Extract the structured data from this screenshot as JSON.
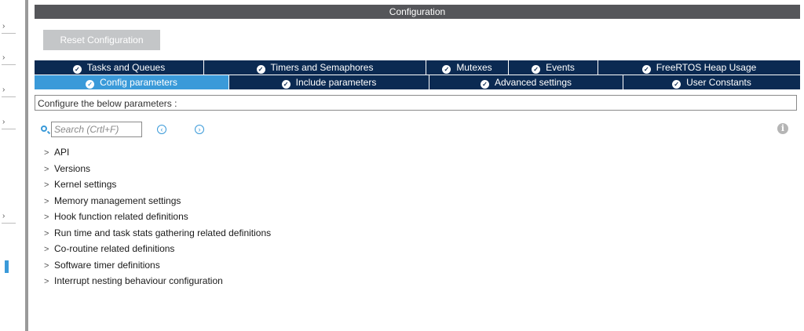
{
  "left_strip": {
    "chevrons": [
      "›",
      "›",
      "›",
      "›",
      "›",
      "›"
    ]
  },
  "window": {
    "title": "Configuration"
  },
  "toolbar": {
    "reset_label": "Reset Configuration"
  },
  "tabs_row_1": [
    {
      "label": "Tasks and Queues",
      "active": false
    },
    {
      "label": "Timers and Semaphores",
      "active": false
    },
    {
      "label": "Mutexes",
      "active": false
    },
    {
      "label": "Events",
      "active": false
    },
    {
      "label": "FreeRTOS Heap Usage",
      "active": false
    }
  ],
  "tabs_row_2": [
    {
      "label": "Config parameters",
      "active": true
    },
    {
      "label": "Include parameters",
      "active": false
    },
    {
      "label": "Advanced settings",
      "active": false
    },
    {
      "label": "User Constants",
      "active": false
    }
  ],
  "description": "Configure the below parameters :",
  "search": {
    "placeholder": "Search (Crtl+F)",
    "value": ""
  },
  "tree": [
    "API",
    "Versions",
    "Kernel settings",
    "Memory management settings",
    "Hook function related definitions",
    "Run time and task stats gathering related definitions",
    "Co-routine related definitions",
    "Software timer definitions",
    "Interrupt nesting behaviour configuration"
  ],
  "colors": {
    "tab_dark": "#0b2a52",
    "tab_active": "#3a9ad9",
    "title_bar": "#55565a",
    "reset_button": "#c4c6c8"
  }
}
